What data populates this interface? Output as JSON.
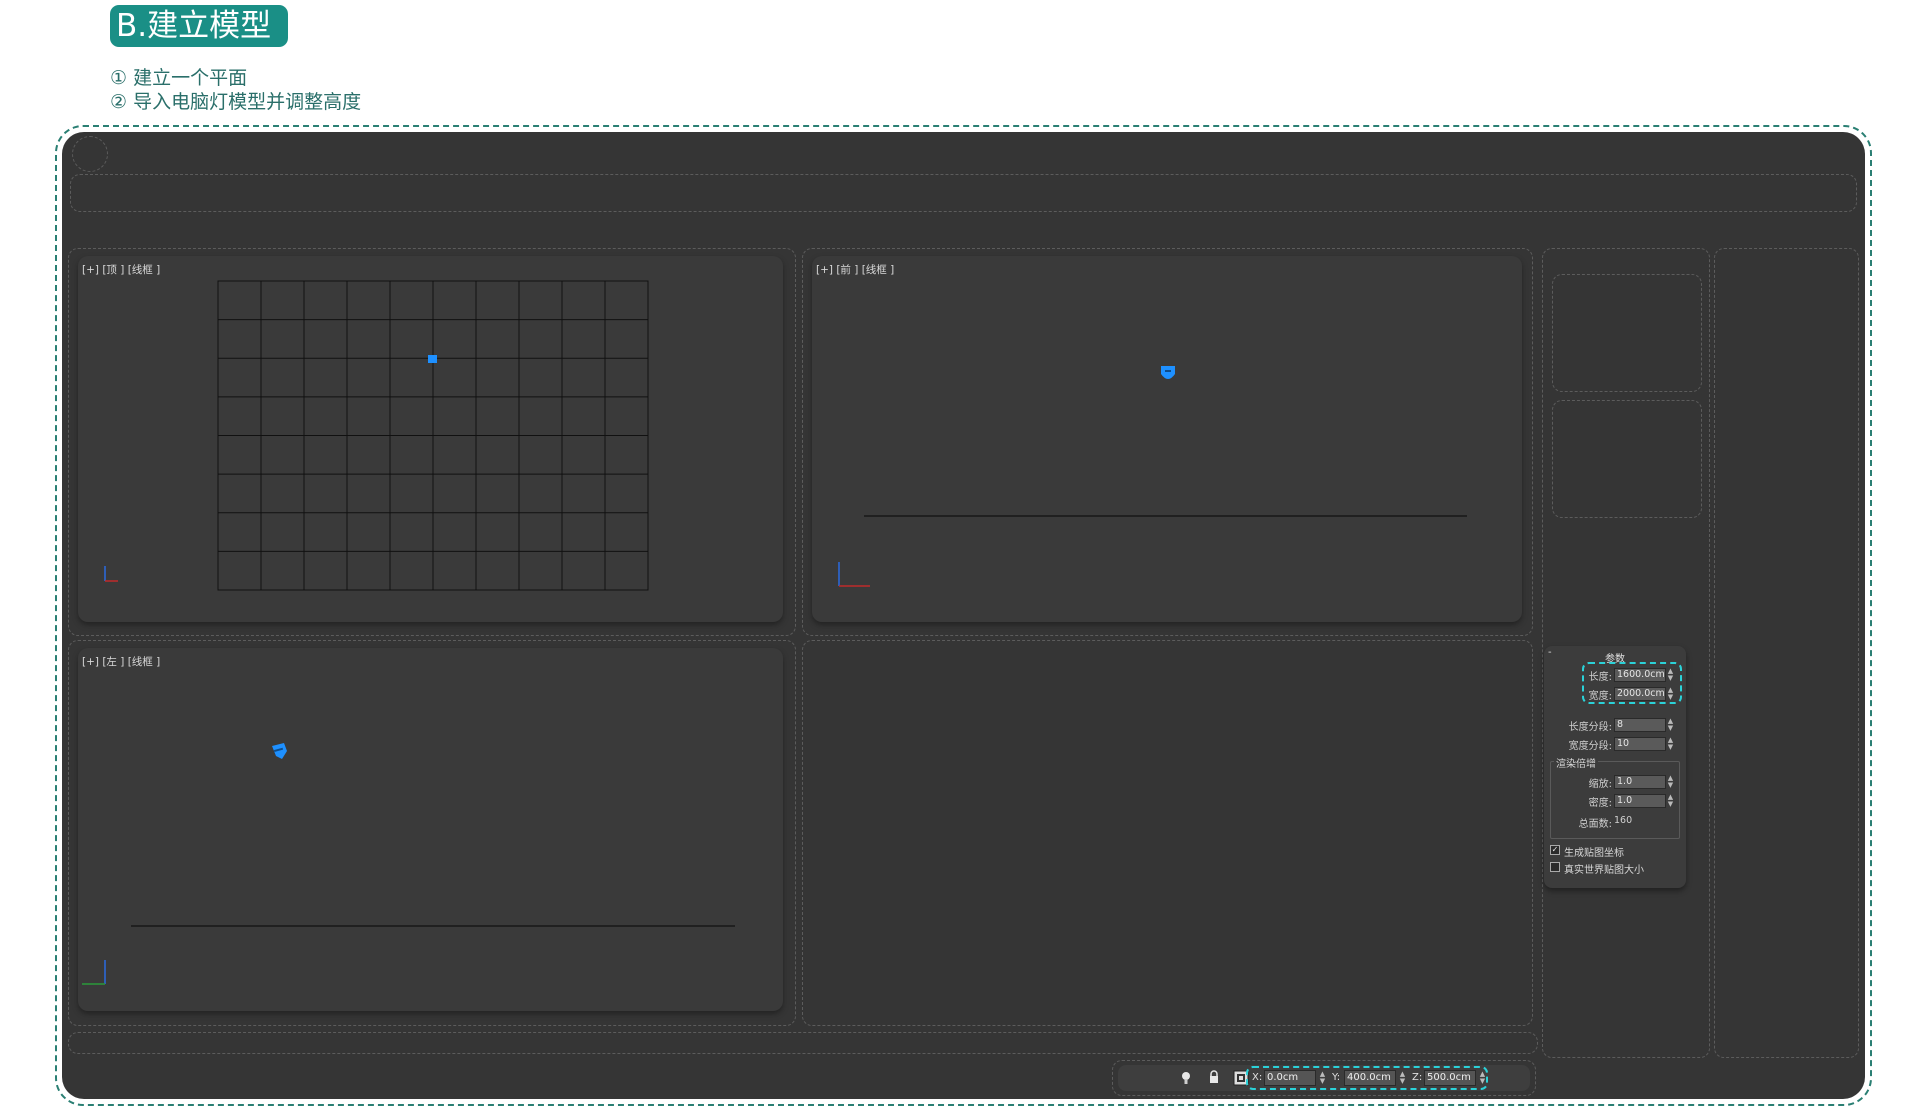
{
  "header": {
    "badge": "B.建立模型",
    "steps": [
      "① 建立一个平面",
      "② 导入电脑灯模型并调整高度"
    ]
  },
  "viewports": {
    "top_label": "[+] [顶 ] [线框 ]",
    "front_label": "[+] [前 ] [线框 ]",
    "left_label": "[+] [左 ] [线框 ]"
  },
  "params": {
    "title": "参数",
    "collapse": "-",
    "length_label": "长度:",
    "length_value": "1600.0cm",
    "width_label": "宽度:",
    "width_value": "2000.0cm",
    "length_segs_label": "长度分段:",
    "length_segs_value": "8",
    "width_segs_label": "宽度分段:",
    "width_segs_value": "10",
    "render_group": "渲染倍增",
    "scale_label": "缩放:",
    "scale_value": "1.0",
    "density_label": "密度:",
    "density_value": "1.0",
    "faces_label": "总面数:",
    "faces_value": "160",
    "gen_map_label": "生成贴图坐标",
    "gen_map_checked": true,
    "real_world_label": "真实世界贴图大小",
    "real_world_checked": false
  },
  "status": {
    "x_label": "X:",
    "x_value": "0.0cm",
    "y_label": "Y:",
    "y_value": "400.0cm",
    "z_label": "Z:",
    "z_value": "500.0cm"
  },
  "colors": {
    "accent_teal": "#1a8f86",
    "highlight_cyan": "#2bd2d8",
    "object_blue": "#1e90ff",
    "app_bg": "#353535"
  }
}
